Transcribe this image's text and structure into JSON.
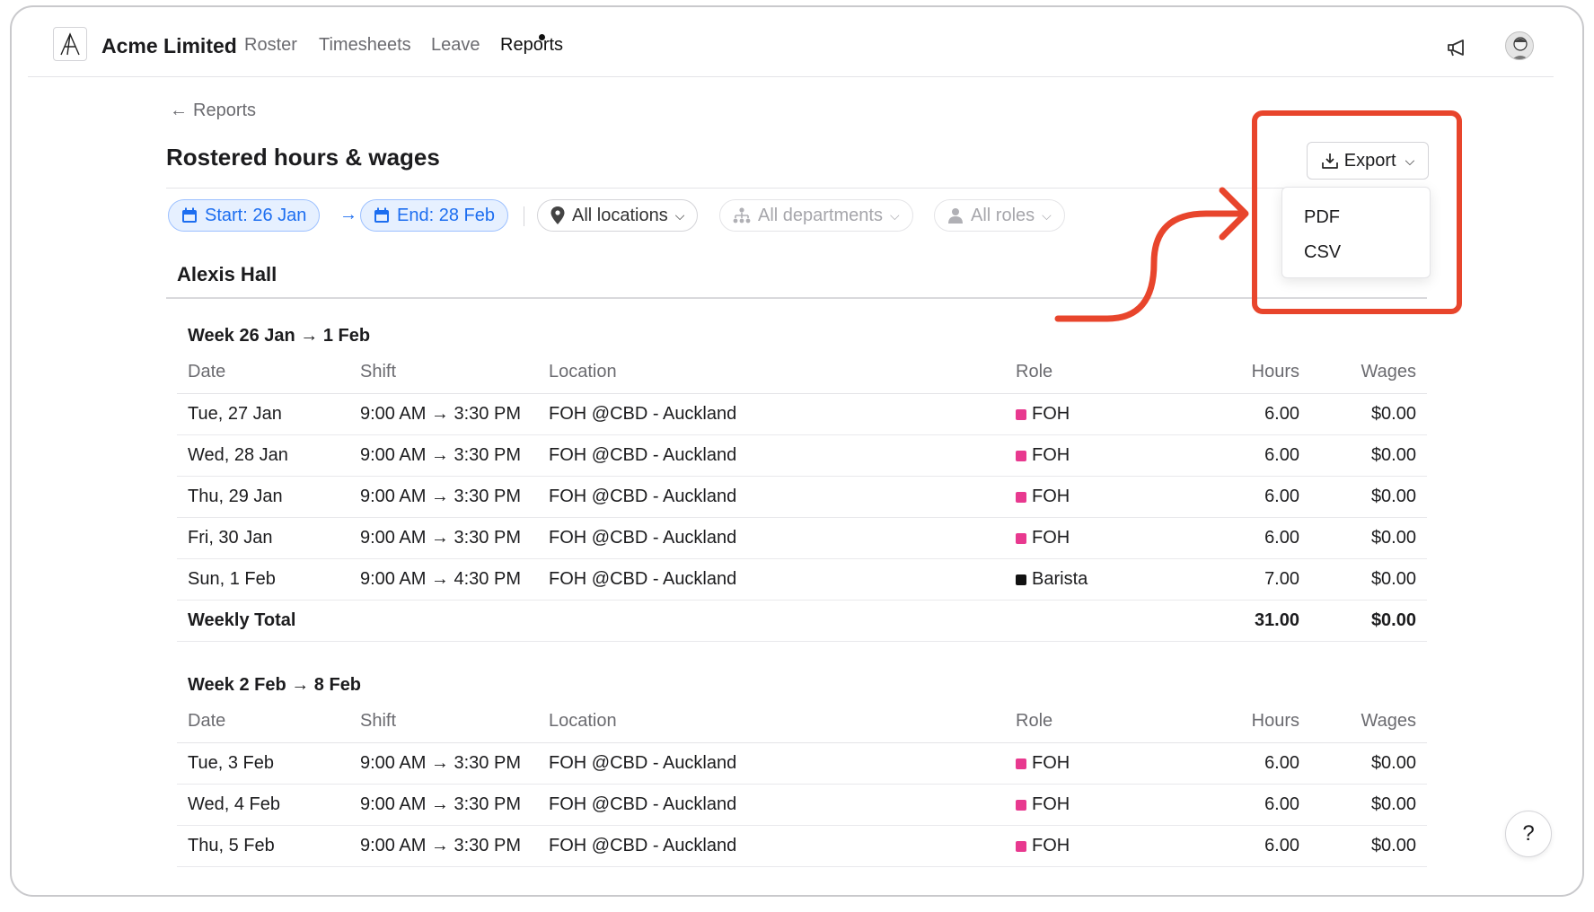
{
  "app": {
    "company": "Acme Limited"
  },
  "nav": {
    "roster": "Roster",
    "timesheets": "Timesheets",
    "leave": "Leave",
    "reports": "Reports"
  },
  "page": {
    "back_label": "Reports",
    "title": "Rostered hours & wages"
  },
  "filters": {
    "start": "Start: 26 Jan",
    "end": "End: 28 Feb",
    "locations": "All locations",
    "departments": "All departments",
    "roles": "All roles"
  },
  "export": {
    "label": "Export",
    "options": [
      "PDF",
      "CSV"
    ]
  },
  "employee": {
    "name": "Alexis Hall"
  },
  "columns": {
    "date": "Date",
    "shift": "Shift",
    "location": "Location",
    "role": "Role",
    "hours": "Hours",
    "wages": "Wages"
  },
  "role_colors": {
    "FOH": "#e8398f",
    "Barista": "#111111"
  },
  "weeks": [
    {
      "label": "Week 26 Jan → 1 Feb",
      "rows": [
        {
          "date": "Tue, 27 Jan",
          "shift": "9:00 AM → 3:30 PM",
          "location": "FOH @CBD - Auckland",
          "role": "FOH",
          "hours": "6.00",
          "wages": "$0.00"
        },
        {
          "date": "Wed, 28 Jan",
          "shift": "9:00 AM → 3:30 PM",
          "location": "FOH @CBD - Auckland",
          "role": "FOH",
          "hours": "6.00",
          "wages": "$0.00"
        },
        {
          "date": "Thu, 29 Jan",
          "shift": "9:00 AM → 3:30 PM",
          "location": "FOH @CBD - Auckland",
          "role": "FOH",
          "hours": "6.00",
          "wages": "$0.00"
        },
        {
          "date": "Fri, 30 Jan",
          "shift": "9:00 AM → 3:30 PM",
          "location": "FOH @CBD - Auckland",
          "role": "FOH",
          "hours": "6.00",
          "wages": "$0.00"
        },
        {
          "date": "Sun, 1 Feb",
          "shift": "9:00 AM → 4:30 PM",
          "location": "FOH @CBD - Auckland",
          "role": "Barista",
          "hours": "7.00",
          "wages": "$0.00"
        }
      ],
      "total": {
        "label": "Weekly Total",
        "hours": "31.00",
        "wages": "$0.00"
      }
    },
    {
      "label": "Week 2 Feb → 8 Feb",
      "rows": [
        {
          "date": "Tue, 3 Feb",
          "shift": "9:00 AM → 3:30 PM",
          "location": "FOH @CBD - Auckland",
          "role": "FOH",
          "hours": "6.00",
          "wages": "$0.00"
        },
        {
          "date": "Wed, 4 Feb",
          "shift": "9:00 AM → 3:30 PM",
          "location": "FOH @CBD - Auckland",
          "role": "FOH",
          "hours": "6.00",
          "wages": "$0.00"
        },
        {
          "date": "Thu, 5 Feb",
          "shift": "9:00 AM → 3:30 PM",
          "location": "FOH @CBD - Auckland",
          "role": "FOH",
          "hours": "6.00",
          "wages": "$0.00"
        }
      ]
    }
  ],
  "help": {
    "label": "?"
  }
}
